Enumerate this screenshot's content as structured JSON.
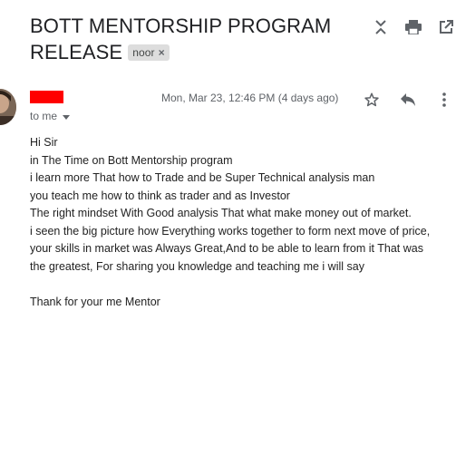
{
  "subject": {
    "line1": "BOTT MENTORSHIP PROGRAM",
    "line2": "RELEASE",
    "label": "noor"
  },
  "icons": {
    "collapse": "unfold-less-icon",
    "print": "print-icon",
    "open_new": "open-in-new-icon",
    "star": "star-icon",
    "reply": "reply-icon",
    "more": "more-vert-icon",
    "caret": "caret-down-icon",
    "label_remove": "close-icon"
  },
  "message": {
    "date": "Mon, Mar 23, 12:46 PM (4 days ago)",
    "to": "to me",
    "sender_redaction_color": "#ff0000",
    "body_lines": [
      "Hi Sir",
      "in The Time on Bott Mentorship program",
      "i learn more That how to Trade and be Super Technical analysis man",
      "you teach me how to think as trader and as Investor",
      "The right mindset With Good analysis That what make money out of market.",
      "i seen the big picture how Everything works together to form next move of price,",
      "your skills in market was Always Great,And to be able to learn from it That was",
      "the greatest, For sharing you knowledge and teaching me  i will say",
      "",
      "Thank for your me Mentor"
    ]
  },
  "colors": {
    "icon": "#5f6368",
    "label_chip_bg": "#dddddd",
    "text": "#202124"
  }
}
